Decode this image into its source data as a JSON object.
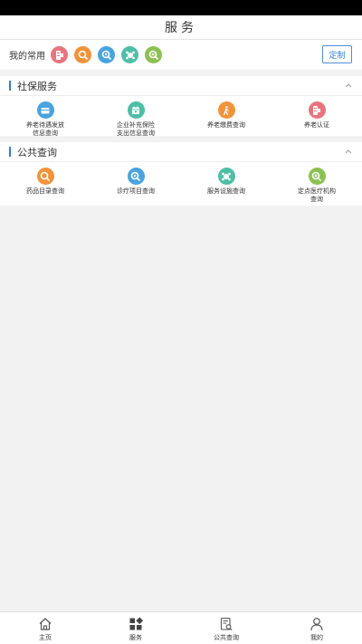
{
  "nav": {
    "title": "服务"
  },
  "favorites": {
    "label": "我的常用",
    "customize_label": "定制",
    "icons": [
      {
        "name": "pension-cert-icon",
        "color": "#e9747d"
      },
      {
        "name": "search-doc-icon",
        "color": "#f2933a"
      },
      {
        "name": "search-icon",
        "color": "#4aa3df"
      },
      {
        "name": "service-network-icon",
        "color": "#4dbfa6"
      },
      {
        "name": "location-search-icon",
        "color": "#8cc152"
      }
    ]
  },
  "social_security": {
    "title": "社保服务",
    "items": [
      {
        "label": "养老待遇发放\n信息查询",
        "icon": "wallet-icon",
        "color": "#4aa3df"
      },
      {
        "label": "企业补充保险\n支出信息查询",
        "icon": "calendar-icon",
        "color": "#4dbfa6"
      },
      {
        "label": "养老缴费查询",
        "icon": "walking-person-icon",
        "color": "#f2933a"
      },
      {
        "label": "养老认证",
        "icon": "pension-cert-icon",
        "color": "#e9747d"
      }
    ]
  },
  "public_query": {
    "title": "公共查询",
    "items": [
      {
        "label": "药品目录查询",
        "icon": "search-doc-icon",
        "color": "#f2933a"
      },
      {
        "label": "诊疗项目查询",
        "icon": "search-icon",
        "color": "#4aa3df"
      },
      {
        "label": "服务设施查询",
        "icon": "service-network-icon",
        "color": "#4dbfa6"
      },
      {
        "label": "定点医疗机构\n查询",
        "icon": "location-search-icon",
        "color": "#8cc152"
      }
    ]
  },
  "tabbar": {
    "tabs": [
      {
        "label": "主页",
        "icon": "home-icon"
      },
      {
        "label": "服务",
        "icon": "grid-icon"
      },
      {
        "label": "公共查询",
        "icon": "query-icon"
      },
      {
        "label": "我的",
        "icon": "person-icon"
      }
    ]
  }
}
